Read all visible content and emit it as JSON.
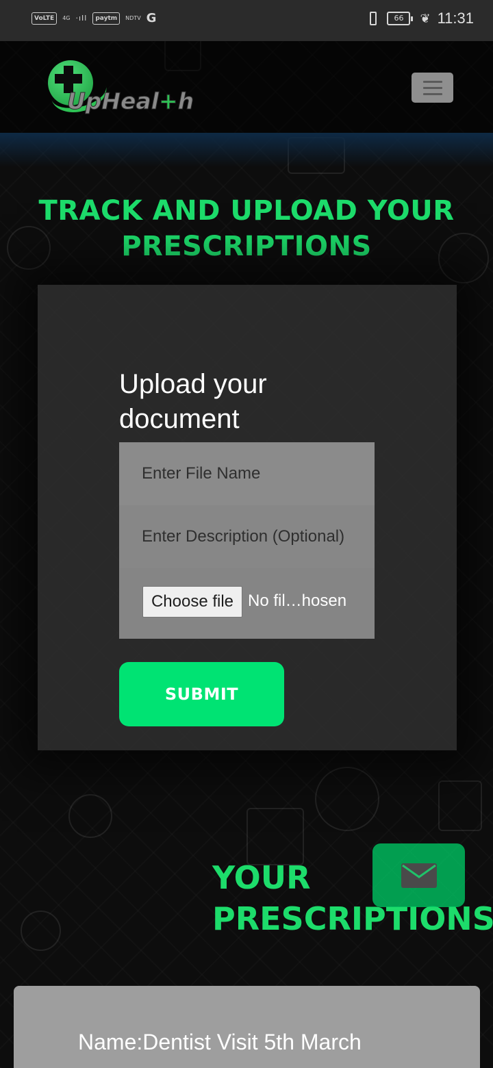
{
  "status_bar": {
    "volte": "VoLTE",
    "network": "4G",
    "signal": "·ıIl",
    "carrier_badge": "paytm",
    "news_badge": "NDTV",
    "g_icon": "G",
    "battery": "66",
    "time": "11:31"
  },
  "navbar": {
    "logo_text_prefix": "UpHeal",
    "logo_text_accent": "+",
    "logo_text_suffix": "h",
    "menu_icon": "hamburger-icon"
  },
  "upload_section": {
    "heading": "TRACK AND UPLOAD YOUR PRESCRIPTIONS",
    "form_title": "Upload your document",
    "file_name_placeholder": "Enter File Name",
    "description_placeholder": "Enter Description (Optional)",
    "choose_file_label": "Choose file",
    "file_status": "No fil…hosen",
    "submit_label": "SUBMIT"
  },
  "prescriptions_section": {
    "heading_line1": "YOUR",
    "heading_line2": "PRESCRIPTIONS",
    "items": [
      {
        "name": "Name:Dentist Visit 5th March"
      }
    ]
  },
  "fab": {
    "icon": "mail-icon"
  },
  "colors": {
    "accent_green": "#1ddc6b",
    "button_green": "#00e373",
    "panel_bg": "#303030"
  }
}
